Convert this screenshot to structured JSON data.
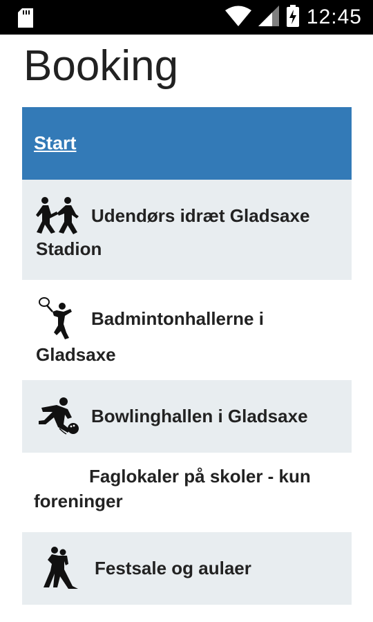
{
  "status_bar": {
    "time": "12:45",
    "icons": [
      "sd-card-icon",
      "wifi-icon",
      "signal-icon",
      "battery-charging-icon"
    ]
  },
  "page": {
    "title": "Booking"
  },
  "list": {
    "start_label": "Start",
    "items": [
      {
        "label": "Udendørs idræt Gladsaxe Stadion",
        "icon": "running-people-icon"
      },
      {
        "label": "Badmintonhallerne i Gladsaxe",
        "icon": "badminton-player-icon"
      },
      {
        "label": "Bowlinghallen i Gladsaxe",
        "icon": "bowling-player-icon"
      },
      {
        "label": "Faglokaler på skoler - kun foreninger",
        "icon": ""
      },
      {
        "label": "Festsale og aulaer",
        "icon": "dancing-couple-icon"
      }
    ]
  },
  "colors": {
    "start_bg": "#337ab7",
    "shaded_bg": "#e8edf0",
    "status_bar_bg": "#000000"
  }
}
